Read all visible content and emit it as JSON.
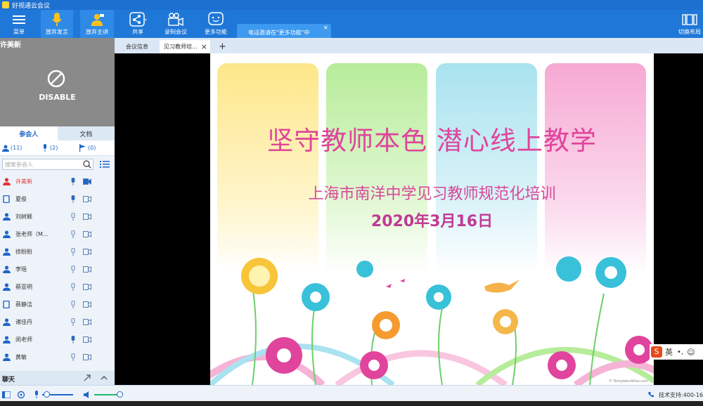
{
  "window": {
    "title": "好视通云会议"
  },
  "toolbar": {
    "menu_label": "菜单",
    "mic_label": "放弃发言",
    "host_label": "放弃主讲",
    "share_label": "共享",
    "record_label": "录制会议",
    "more_label": "更多功能",
    "layout_label": "切换布局"
  },
  "tip": {
    "text": "电话邀请在\"更多功能\"中",
    "close": "×"
  },
  "video": {
    "name": "许美新",
    "state": "DISABLE"
  },
  "left_tabs": {
    "participants": "参会人",
    "docs": "文档"
  },
  "counts": {
    "people": "(11)",
    "speakers": "(2)",
    "flags": "(0)"
  },
  "search": {
    "placeholder": "搜索参会人"
  },
  "participants": [
    {
      "name": "许美新",
      "highlight": true
    },
    {
      "name": "夏俊"
    },
    {
      "name": "刘树颖"
    },
    {
      "name": "张老师（M..."
    },
    {
      "name": "徐盼盼"
    },
    {
      "name": "李瑶"
    },
    {
      "name": "蔡亚明"
    },
    {
      "name": "蔡静洁"
    },
    {
      "name": "诸佳丹"
    },
    {
      "name": "闵老师"
    },
    {
      "name": "黄敏"
    }
  ],
  "chat": {
    "label": "聊天"
  },
  "doctabs": {
    "info": "会议信息",
    "doc": "见习教师培...",
    "close": "×",
    "add": "+"
  },
  "slide": {
    "title": "坚守教师本色 潜心线上教学",
    "subtitle": "上海市南洋中学见习教师规范化培训",
    "date": "2020年3月16日",
    "credit": "© TemplatesWise.com"
  },
  "ime": {
    "label": "英"
  },
  "status": {
    "support": "技术支持:400-16"
  },
  "colors": {
    "accent": "#1f78d8",
    "title_pink": "#e0449c"
  }
}
